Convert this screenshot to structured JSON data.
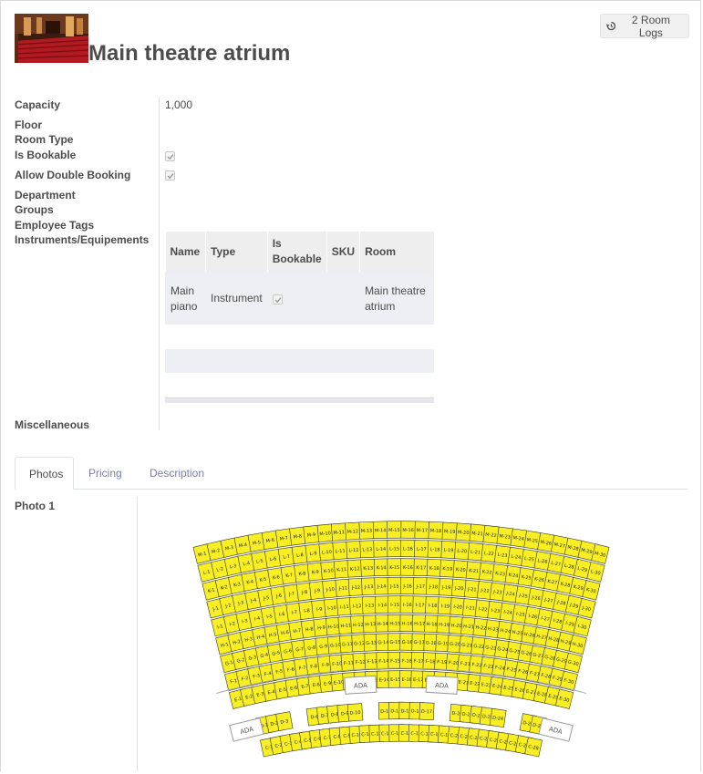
{
  "header": {
    "title": "Main theatre atrium",
    "logs_button_label": "2 Room Logs"
  },
  "fields": {
    "capacity": {
      "label": "Capacity",
      "value": "1,000"
    },
    "floor": {
      "label": "Floor",
      "value": ""
    },
    "room_type": {
      "label": "Room Type",
      "value": ""
    },
    "is_bookable": {
      "label": "Is Bookable",
      "checked": true
    },
    "allow_double_booking": {
      "label": "Allow Double Booking",
      "checked": true
    },
    "department": {
      "label": "Department",
      "value": ""
    },
    "groups": {
      "label": "Groups",
      "value": ""
    },
    "employee_tags": {
      "label": "Employee Tags",
      "value": ""
    },
    "instruments": {
      "label": "Instruments/Equipements"
    },
    "miscellaneous": {
      "label": "Miscellaneous",
      "value": ""
    }
  },
  "instruments_table": {
    "columns": [
      "Name",
      "Type",
      "Is Bookable",
      "SKU",
      "Room"
    ],
    "rows": [
      {
        "name": "Main piano",
        "type": "Instrument",
        "is_bookable": true,
        "sku": "",
        "room": "Main theatre atrium"
      }
    ]
  },
  "tabs": [
    {
      "label": "Photos",
      "active": true
    },
    {
      "label": "Pricing",
      "active": false
    },
    {
      "label": "Description",
      "active": false
    }
  ],
  "photos": {
    "photo1_label": "Photo 1",
    "seat_rows": [
      "M",
      "L",
      "K",
      "J",
      "I",
      "H",
      "G",
      "F",
      "E",
      "D",
      "C"
    ],
    "ada_label": "ADA"
  },
  "colors": {
    "seat_fill": "#f7ef23",
    "link": "#7c7bad",
    "table_header": "#eeeeee",
    "table_row": "#eeeff5"
  }
}
